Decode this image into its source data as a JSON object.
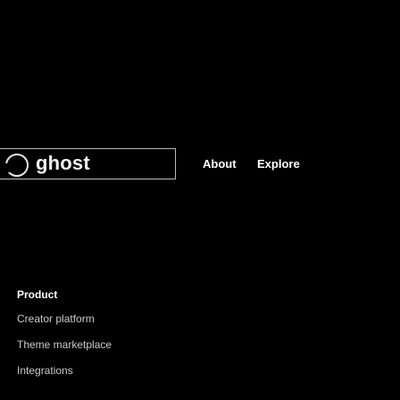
{
  "nav": {
    "logo_text": "ghost",
    "links": [
      {
        "label": "About"
      },
      {
        "label": "Explore"
      }
    ]
  },
  "footer": {
    "section_title": "Product",
    "items": [
      {
        "label": "Creator platform"
      },
      {
        "label": "Theme marketplace"
      },
      {
        "label": "Integrations"
      }
    ]
  },
  "colors": {
    "background": "#000000",
    "text_primary": "#ffffff",
    "text_secondary": "#c9c9c9",
    "logo_border": "#b8b8b8"
  },
  "icons": {
    "logo_mark": "ghost-logo-circle-icon"
  }
}
